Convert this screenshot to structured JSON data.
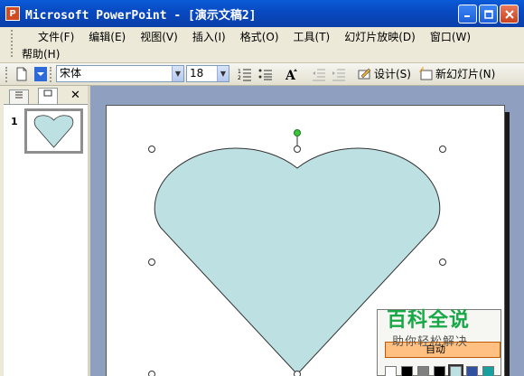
{
  "window": {
    "title": "Microsoft PowerPoint - [演示文稿2]",
    "app_icon": "powerpoint-icon",
    "buttons": [
      "minimize",
      "maximize",
      "close"
    ]
  },
  "menu": {
    "row1": [
      "文件(F)",
      "编辑(E)",
      "视图(V)",
      "插入(I)",
      "格式(O)",
      "工具(T)",
      "幻灯片放映(D)",
      "窗口(W)"
    ],
    "row2": [
      "帮助(H)"
    ]
  },
  "toolbar": {
    "font_name": "宋体",
    "font_size": "18",
    "design_label": "设计(S)",
    "new_slide_label": "新幻灯片(N)"
  },
  "slides_pane": {
    "tabs": [
      "outline-tab",
      "slides-tab"
    ],
    "slide_number": "1"
  },
  "shape": {
    "type": "heart",
    "fill": "#BDE1E2",
    "stroke": "#333333"
  },
  "color_popup": {
    "highlighted_label": "自动",
    "highlight_color": "#FFC081",
    "swatches": [
      "#FFFFFF",
      "#000000",
      "#808080",
      "#000000",
      "#BDE1E2",
      "#3050A0",
      "#18A0A0",
      "#20A060"
    ]
  },
  "watermark": {
    "title": "百科全说",
    "subtitle": "助你轻松解决"
  }
}
